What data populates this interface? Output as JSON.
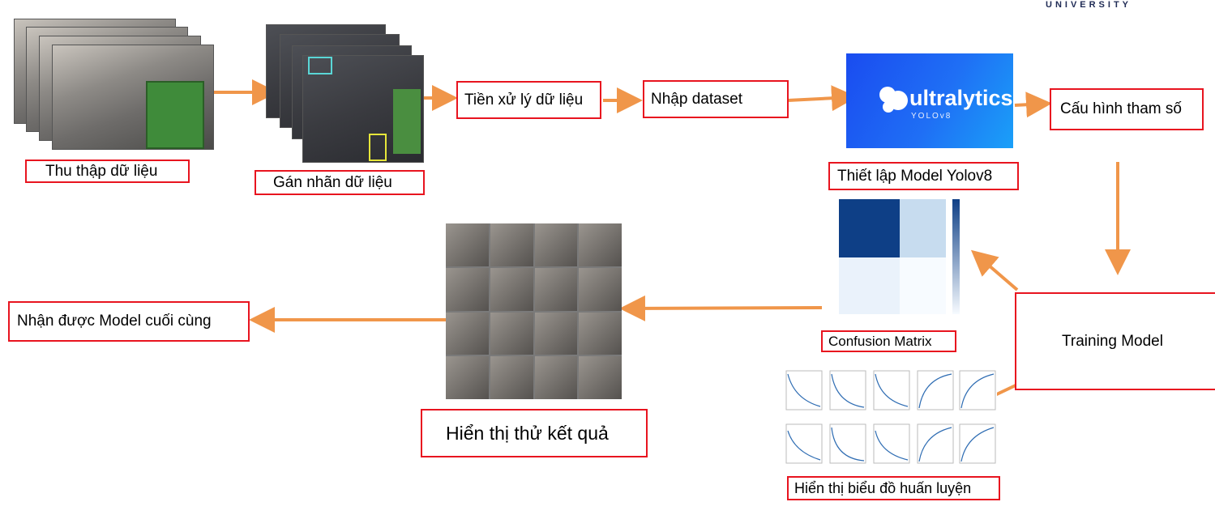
{
  "header": {
    "university_text": "UNIVERSITY"
  },
  "steps": {
    "collect": "Thu thập dữ liệu",
    "label": "Gán nhãn dữ liệu",
    "preprocess": "Tiền xử lý dữ liệu",
    "import": "Nhập dataset",
    "setup_model": "Thiết lập Model Yolov8",
    "config": "Cấu hình tham số",
    "training": "Training Model",
    "confusion": "Confusion Matrix",
    "training_plots": "Hiển thị biểu đồ huấn luyện",
    "test_results": "Hiển thị thử kết quả",
    "final_model": "Nhận được Model cuối cùng"
  },
  "logo": {
    "brand": "ultralytics",
    "model": "YOLOv8"
  },
  "colors": {
    "box_border": "#e8141f",
    "arrow": "#f0964a",
    "logo_bg": "#1f6ff5"
  }
}
